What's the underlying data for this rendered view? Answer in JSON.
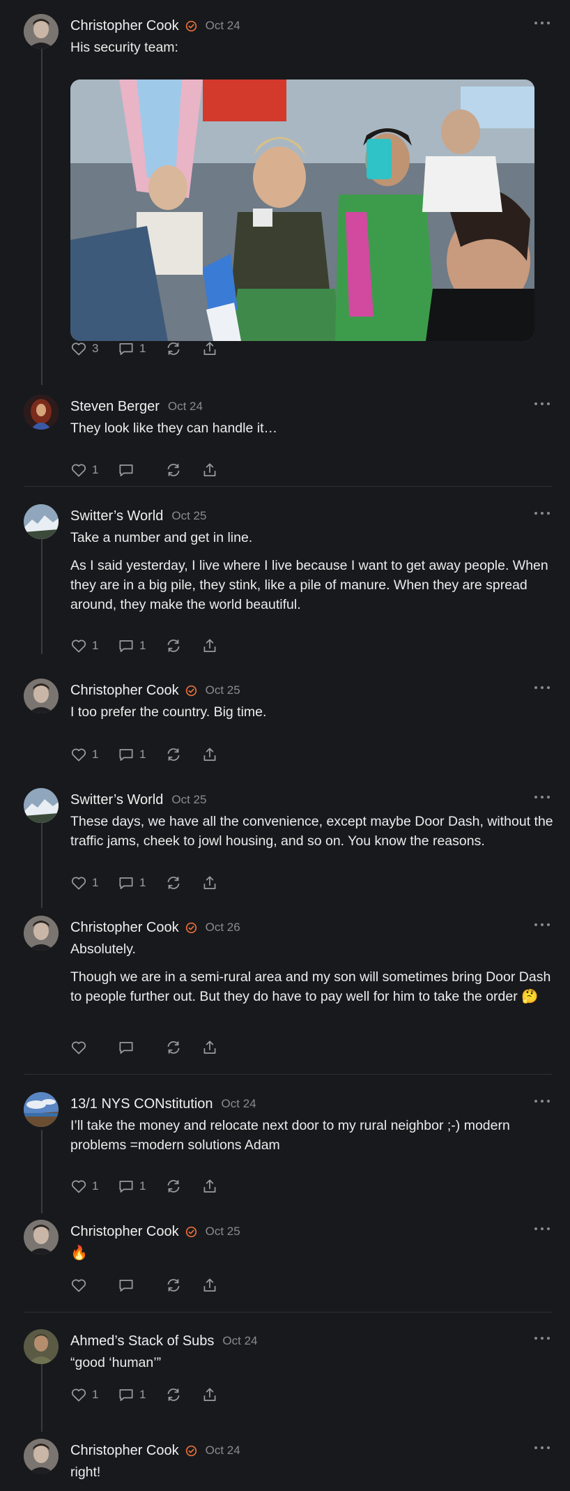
{
  "colors": {
    "background": "#18191c",
    "verified": "#e8703a",
    "muted": "#8a8b8f"
  },
  "comments": [
    {
      "name": "Christopher Cook",
      "verified": true,
      "date": "Oct 24",
      "paragraphs": [
        "His security team:"
      ],
      "has_image": true,
      "likes": "3",
      "replies": "1"
    },
    {
      "name": "Steven Berger",
      "verified": false,
      "date": "Oct 24",
      "paragraphs": [
        "They look like they can handle it…"
      ],
      "likes": "1",
      "replies": ""
    },
    {
      "name": "Switter’s World",
      "verified": false,
      "date": "Oct 25",
      "paragraphs": [
        "Take a number and get in line.",
        "As I said yesterday, I live where I live because I want to get away people. When they are in a big pile, they stink, like a pile of manure. When they are spread around, they make the world beautiful."
      ],
      "likes": "1",
      "replies": "1"
    },
    {
      "name": "Christopher Cook",
      "verified": true,
      "date": "Oct 25",
      "paragraphs": [
        "I too prefer the country. Big time."
      ],
      "likes": "1",
      "replies": "1"
    },
    {
      "name": "Switter’s World",
      "verified": false,
      "date": "Oct 25",
      "paragraphs": [
        "These days, we have all the convenience, except maybe Door Dash, without the traffic jams, cheek to jowl housing, and so on. You know the reasons."
      ],
      "likes": "1",
      "replies": "1"
    },
    {
      "name": "Christopher Cook",
      "verified": true,
      "date": "Oct 26",
      "paragraphs": [
        "Absolutely.",
        "Though we are in a semi-rural area and my son will sometimes bring Door Dash to people further out. But they do have to pay well for him to take the order 🤔"
      ],
      "likes": "",
      "replies": ""
    },
    {
      "name": "13/1 NYS CONstitution",
      "verified": false,
      "date": "Oct 24",
      "paragraphs": [
        "I’ll take the money and relocate next door to my rural neighbor ;-) modern problems =modern solutions Adam"
      ],
      "likes": "1",
      "replies": "1"
    },
    {
      "name": "Christopher Cook",
      "verified": true,
      "date": "Oct 25",
      "paragraphs": [
        "🔥"
      ],
      "likes": "",
      "replies": ""
    },
    {
      "name": "Ahmed’s Stack of Subs",
      "verified": false,
      "date": "Oct 24",
      "paragraphs": [
        "“good ‘human’”"
      ],
      "likes": "1",
      "replies": "1"
    },
    {
      "name": "Christopher Cook",
      "verified": true,
      "date": "Oct 24",
      "paragraphs": [
        "right!"
      ],
      "likes": "",
      "replies": ""
    }
  ]
}
